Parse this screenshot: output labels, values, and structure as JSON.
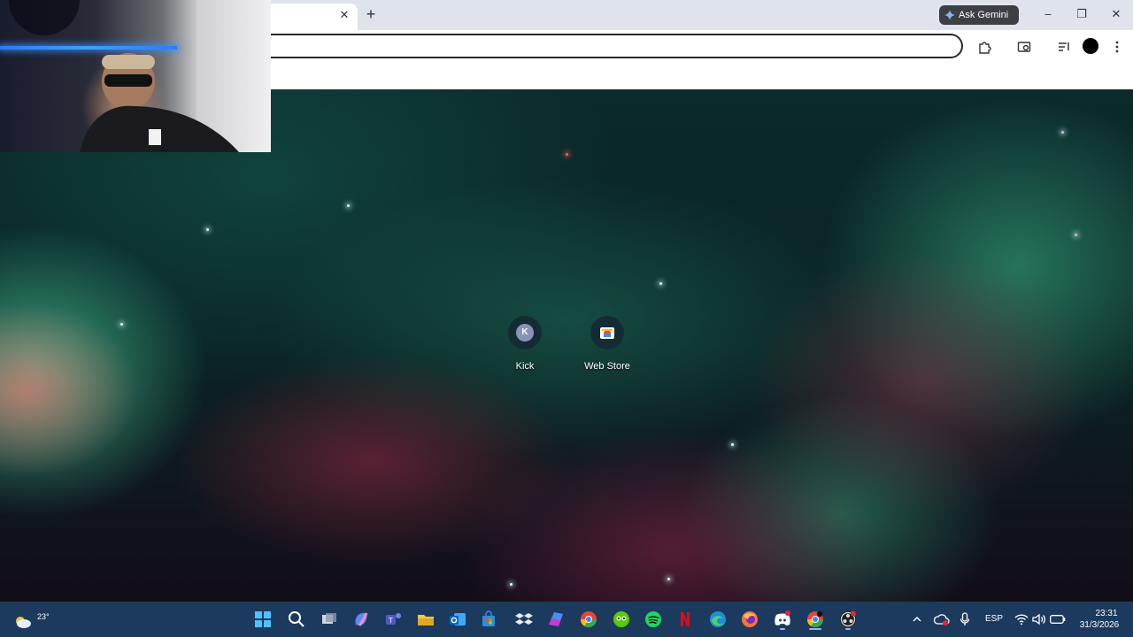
{
  "browser": {
    "tab_close_glyph": "✕",
    "new_tab_glyph": "+",
    "ask_gemini_label": "Ask Gemini",
    "window_controls": {
      "minimize": "–",
      "maximize": "❐",
      "close": "✕"
    },
    "toolbar_icons": [
      "extensions-icon",
      "cast-icon",
      "reading-list-icon",
      "profile-avatar",
      "menu-icon"
    ]
  },
  "new_tab_page": {
    "shortcuts": [
      {
        "label": "Kick",
        "initial": "K",
        "icon": "kick-icon"
      },
      {
        "label": "Web Store",
        "icon": "web-store-icon"
      }
    ]
  },
  "taskbar": {
    "weather_temp": "23°",
    "apps": [
      "start-icon",
      "search-icon",
      "task-view-icon",
      "copilot-icon",
      "teams-icon",
      "file-explorer-icon",
      "outlook-icon",
      "store-icon",
      "dropbox-icon",
      "office-icon",
      "chrome-icon",
      "duolingo-icon",
      "spotify-icon",
      "netflix-icon",
      "edge-icon",
      "firefox-icon",
      "discord-icon",
      "chrome-active-icon",
      "obs-icon"
    ],
    "tray": {
      "language": "ESP",
      "time": "23:31",
      "date": "31/3/2026"
    },
    "accent_color": "#1c3a5e"
  }
}
